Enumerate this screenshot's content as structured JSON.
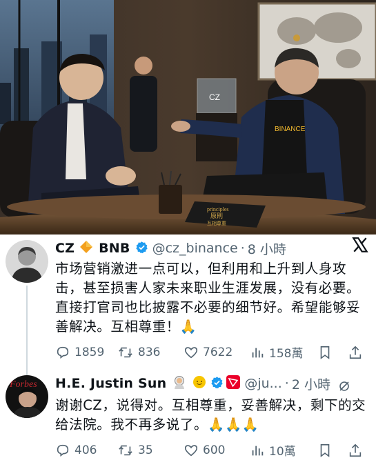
{
  "photo": {
    "book_text_line1": "principles",
    "book_text_line2": "原則",
    "book_text_line3": "互相尊重",
    "shirt_text": "BINANCE",
    "cube_text": "CZ"
  },
  "tweets": [
    {
      "author_name": "CZ",
      "author_badge_text": "BNB",
      "handle": "@cz_binance",
      "separator": "·",
      "time": "8 小時",
      "text": "市场营销激进一点可以，但利用和上升到人身攻击，甚至损害人家未来职业生涯发展，没有必要。直接打官司也比披露不必要的细节好。希望能够妥善解决。互相尊重！🙏",
      "replies": "1859",
      "retweets": "836",
      "likes": "7622",
      "views": "158萬",
      "icons": [
        "diamond-icon",
        "verified-badge-icon",
        "x-logo-icon",
        "reply-icon",
        "retweet-icon",
        "like-icon",
        "views-icon",
        "bookmark-icon",
        "share-icon"
      ]
    },
    {
      "author_name": "H.E. Justin Sun",
      "handle": "@ju...",
      "separator": "·",
      "time": "2 小時",
      "avatar_label": "Forbes",
      "text": "谢谢CZ，说得对。互相尊重，妥善解决，剩下的交给法院。我不再多说了。🙏🙏🙏",
      "replies": "406",
      "retweets": "35",
      "likes": "600",
      "views": "10萬",
      "icons": [
        "astronaut-icon",
        "sun-icon",
        "verified-badge-icon",
        "tron-icon",
        "more-icon",
        "reply-icon",
        "retweet-icon",
        "like-icon",
        "views-icon",
        "bookmark-icon",
        "share-icon"
      ]
    }
  ],
  "colors": {
    "accent": "#1d9bf0",
    "secondary_text": "#536471",
    "bnb": "#f3ba2f",
    "tron": "#eb0029"
  }
}
